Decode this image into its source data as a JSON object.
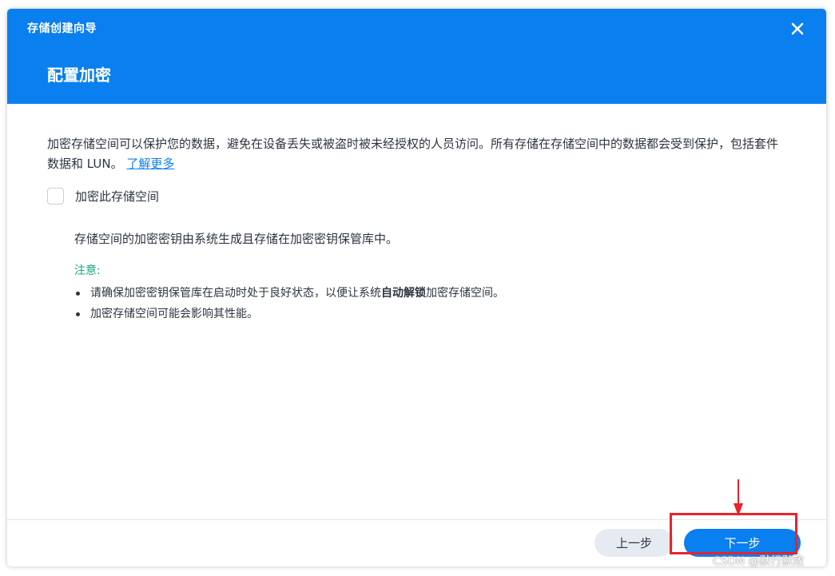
{
  "window": {
    "title": "存储创建向导",
    "step_title": "配置加密",
    "close_icon": "close-icon"
  },
  "content": {
    "description": "加密存储空间可以保护您的数据，避免在设备丢失或被盗时被未经授权的人员访问。所有存储在存储空间中的数据都会受到保护，包括套件数据和 LUN。",
    "learn_more": "了解更多",
    "encrypt_checkbox": {
      "label": "加密此存储空间",
      "checked": false
    },
    "key_note": "存储空间的加密密钥由系统生成且存储在加密密钥保管库中。",
    "notes_title": "注意:",
    "notes": {
      "item1_before": "请确保加密密钥保管库在启动时处于良好状态，以便让系统",
      "item1_bold": "自动解锁",
      "item1_after": "加密存储空间。",
      "item2": "加密存储空间可能会影响其性能。"
    }
  },
  "footer": {
    "prev_label": "上一步",
    "next_label": "下一步"
  },
  "annotation": {
    "highlight_color": "#e8232a"
  },
  "watermark": "CSDN @默行默致",
  "colors": {
    "accent": "#0a7ff0",
    "note_green": "#17a584"
  }
}
